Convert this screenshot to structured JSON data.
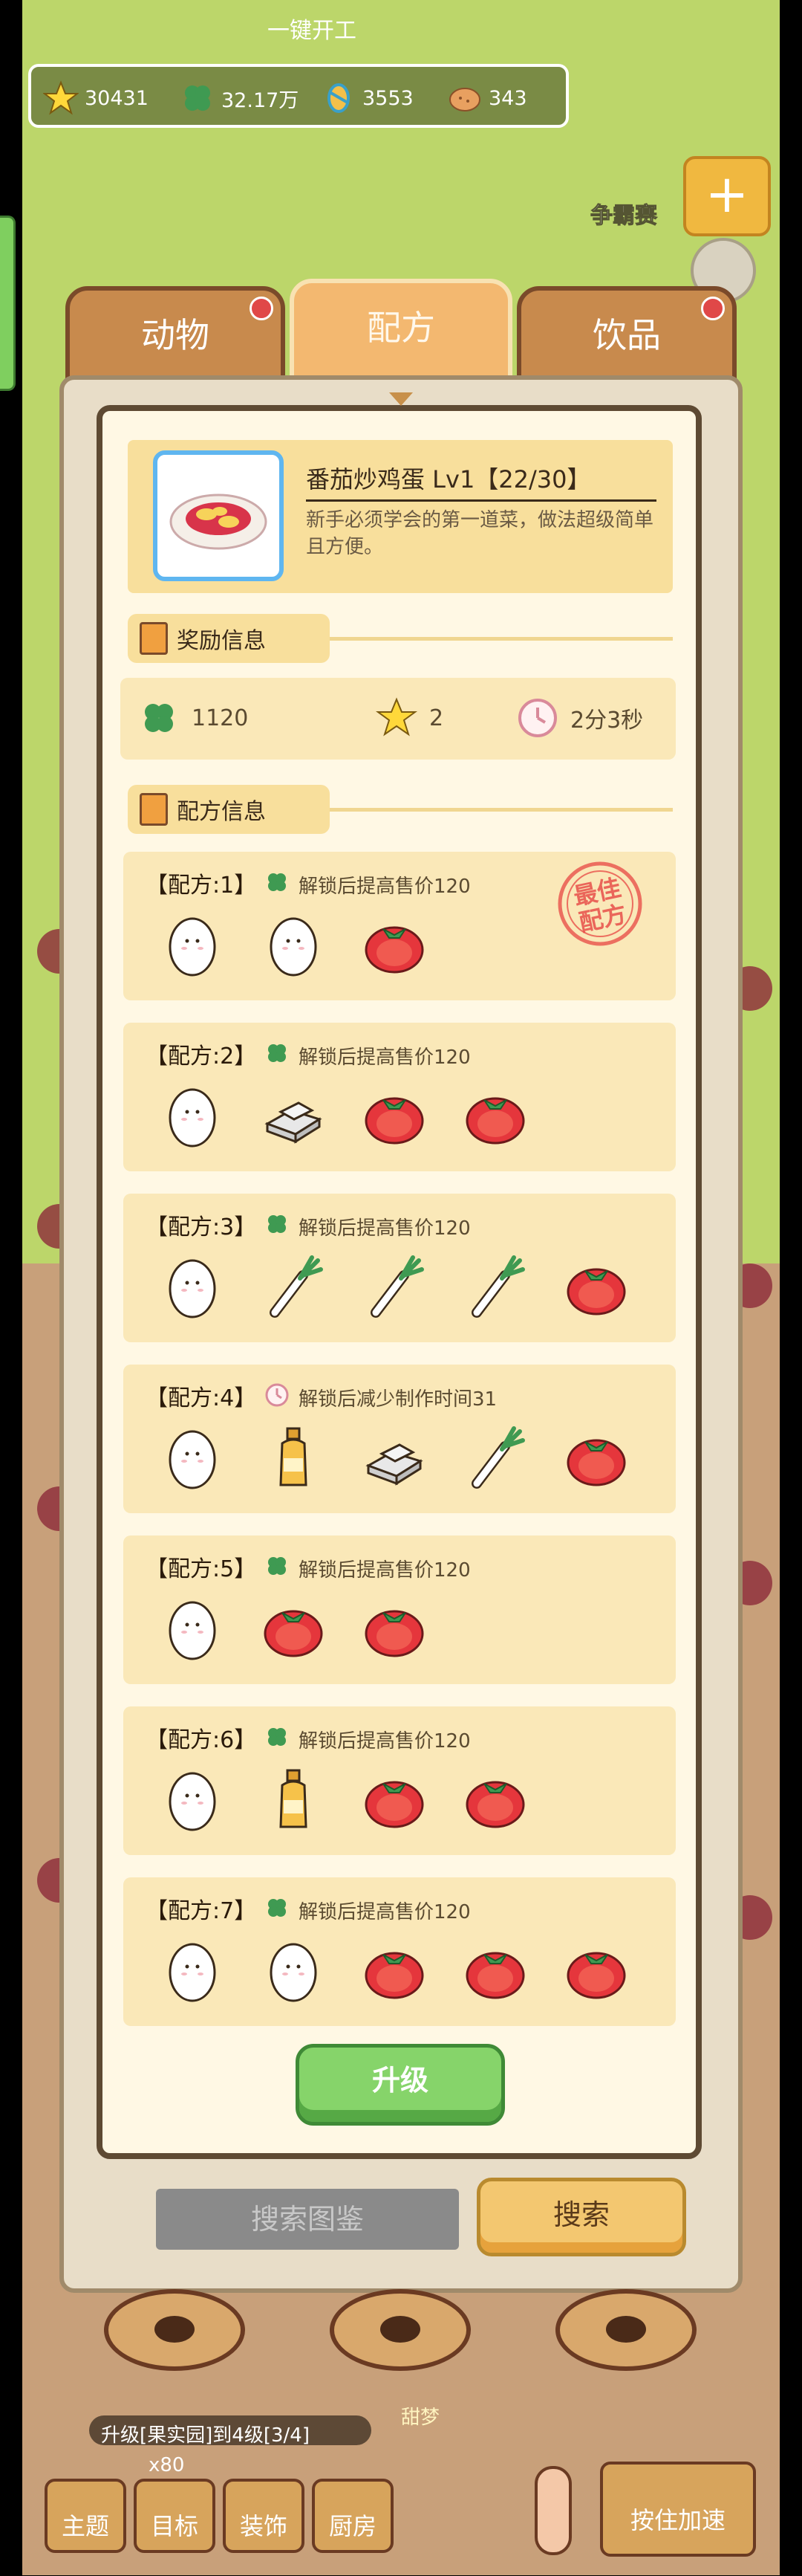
{
  "top_label": "一键开工",
  "resources": [
    {
      "icon": "star-icon",
      "value": "30431"
    },
    {
      "icon": "clover-icon",
      "value": "32.17万"
    },
    {
      "icon": "candy-icon",
      "value": "3553"
    },
    {
      "icon": "cookie-icon",
      "value": "343"
    }
  ],
  "right_label": "争霸赛",
  "right_plus": "+",
  "tabs": [
    {
      "label": "动物",
      "active": false
    },
    {
      "label": "配方",
      "active": true
    },
    {
      "label": "饮品",
      "active": false
    }
  ],
  "dish": {
    "title": "番茄炒鸡蛋 Lv1【22/30】",
    "description": "新手必须学会的第一道菜，做法超级简单且方便。"
  },
  "sections": {
    "reward": "奖励信息",
    "recipe": "配方信息"
  },
  "rewards": [
    {
      "icon": "clover-icon",
      "value": "1120"
    },
    {
      "icon": "star-icon",
      "value": "2"
    },
    {
      "icon": "clock-icon",
      "value": "2分3秒"
    }
  ],
  "recipes": [
    {
      "title": "【配方:1】",
      "bonus_icon": "clover-icon",
      "bonus": "解锁后提高售价120",
      "best": true,
      "ingredients": [
        "egg",
        "egg",
        "tomato"
      ]
    },
    {
      "title": "【配方:2】",
      "bonus_icon": "clover-icon",
      "bonus": "解锁后提高售价120",
      "best": false,
      "ingredients": [
        "egg",
        "tofu",
        "tomato",
        "tomato"
      ]
    },
    {
      "title": "【配方:3】",
      "bonus_icon": "clover-icon",
      "bonus": "解锁后提高售价120",
      "best": false,
      "ingredients": [
        "egg",
        "scallion",
        "scallion",
        "scallion",
        "tomato"
      ]
    },
    {
      "title": "【配方:4】",
      "bonus_icon": "clock-icon",
      "bonus": "解锁后减少制作时间31",
      "best": false,
      "ingredients": [
        "egg",
        "oil",
        "tofu",
        "scallion",
        "tomato"
      ]
    },
    {
      "title": "【配方:5】",
      "bonus_icon": "clover-icon",
      "bonus": "解锁后提高售价120",
      "best": false,
      "ingredients": [
        "egg",
        "tomato",
        "tomato"
      ]
    },
    {
      "title": "【配方:6】",
      "bonus_icon": "clover-icon",
      "bonus": "解锁后提高售价120",
      "best": false,
      "ingredients": [
        "egg",
        "oil",
        "tomato",
        "tomato"
      ]
    },
    {
      "title": "【配方:7】",
      "bonus_icon": "clover-icon",
      "bonus": "解锁后提高售价120",
      "best": false,
      "ingredients": [
        "egg",
        "egg",
        "tomato",
        "tomato",
        "tomato"
      ]
    }
  ],
  "best_stamp_text": "最佳配方",
  "upgrade_label": "升级",
  "search": {
    "placeholder": "搜索图鉴",
    "button": "搜索"
  },
  "bottom": {
    "progress_text": "升级[果实园]到4级[3/4]",
    "count_text": "x80",
    "sweet_label": "甜梦",
    "buttons": [
      "主题",
      "目标",
      "装饰",
      "厨房"
    ],
    "speed_label": "按住加速"
  }
}
